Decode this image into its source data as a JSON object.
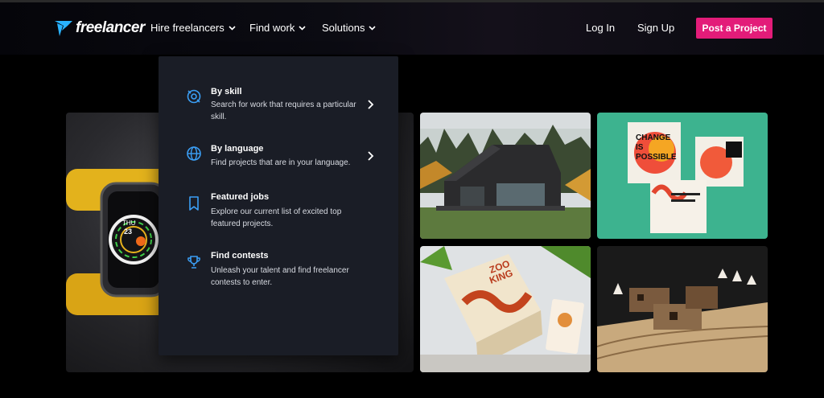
{
  "header": {
    "logo_text": "freelancer",
    "nav": [
      {
        "label": "Hire freelancers",
        "icon": "chevron-down-icon"
      },
      {
        "label": "Find work",
        "icon": "chevron-down-icon"
      },
      {
        "label": "Solutions",
        "icon": "chevron-down-icon"
      }
    ],
    "login_label": "Log In",
    "signup_label": "Sign Up",
    "post_project_label": "Post a Project",
    "accent_color": "#e31c79",
    "logo_color": "#29b2fe"
  },
  "dropdown": {
    "items": [
      {
        "title": "By skill",
        "description": "Search for work that requires a particular skill.",
        "icon": "skill-badge-icon",
        "has_submenu": true
      },
      {
        "title": "By language",
        "description": "Find projects that are in your language.",
        "icon": "globe-icon",
        "has_submenu": true
      },
      {
        "title": "Featured jobs",
        "description": "Explore our current list of excited top featured projects.",
        "icon": "bookmark-icon",
        "has_submenu": false
      },
      {
        "title": "Find contests",
        "description": "Unleash your talent and find freelancer contests to enter.",
        "icon": "trophy-icon",
        "has_submenu": false
      }
    ],
    "icon_color": "#3b9ff6"
  },
  "gallery": {
    "cards": [
      {
        "name": "smartwatch-image"
      },
      {
        "name": "cabin-image"
      },
      {
        "name": "poster-design-image"
      },
      {
        "name": "zoo-king-packaging-image"
      },
      {
        "name": "architecture-model-image"
      }
    ],
    "poster_text": [
      "CHANGE",
      "IS",
      "POSSIBLE"
    ],
    "packaging_text": [
      "ZOO",
      "KING"
    ],
    "watch_text": [
      "THU",
      "23"
    ]
  }
}
